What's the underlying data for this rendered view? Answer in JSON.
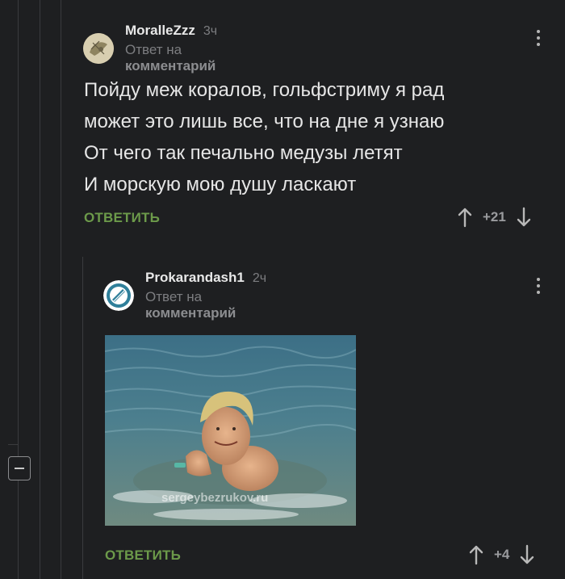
{
  "comments": [
    {
      "username": "MoralleZzz",
      "time": "3ч",
      "reply_prefix": "Ответ на",
      "reply_link": "комментарий",
      "body_lines": [
        "Пойду меж коралов, гольфстриму я рад",
        "может это лишь все, что на дне я узнаю",
        "От чего так печально медузы летят",
        "И морскую мою душу ласкают"
      ],
      "reply_label": "ОТВЕТИТЬ",
      "rating": "+21"
    },
    {
      "username": "Prokarandash1",
      "time": "2ч",
      "reply_prefix": "Ответ на",
      "reply_link": "комментарий",
      "image_watermark": "sergeybezrukov.ru",
      "reply_label": "ОТВЕТИТЬ",
      "rating": "+4"
    }
  ],
  "colors": {
    "background": "#1e1f21",
    "reply_green": "#6c9a4a",
    "muted": "#7c7d80"
  },
  "icons": [
    "kebab-menu-icon",
    "arrow-up-icon",
    "arrow-down-icon",
    "collapse-icon"
  ]
}
